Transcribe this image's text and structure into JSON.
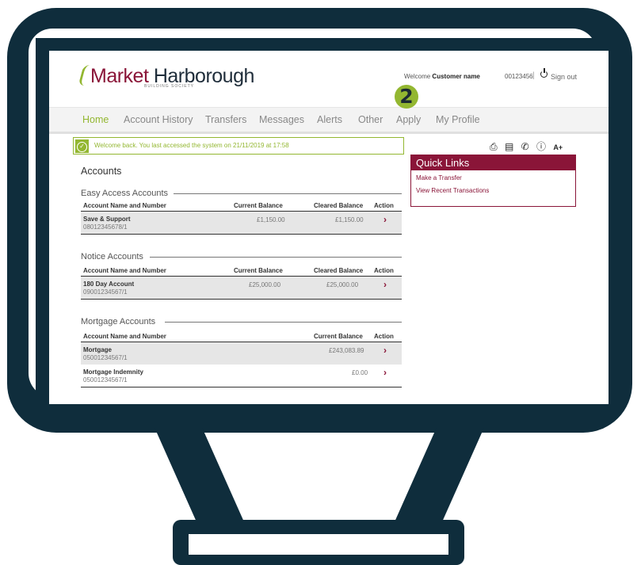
{
  "header": {
    "brand_market": "Market",
    "brand_harborough": " Harborough",
    "brand_subtitle": "BUILDING SOCIETY",
    "welcome_prefix": "Welcome ",
    "customer_name": "Customer name",
    "account_id": "00123456",
    "separator": "|",
    "sign_out": "Sign out"
  },
  "nav": {
    "items": [
      "Home",
      "Account History",
      "Transfers",
      "Messages",
      "Alerts",
      "Other",
      "Apply",
      "My Profile"
    ],
    "step_badge": "2"
  },
  "notice": {
    "text": "Welcome back. You last accessed the system on 21/11/2019 at 17:58"
  },
  "toolbar": {
    "icons": [
      "printer-icon",
      "id-card-icon",
      "phone-icon",
      "help-icon",
      "text-size-icon"
    ],
    "text_size_label": "A+"
  },
  "quick_links": {
    "title": "Quick Links",
    "links": [
      "Make a Transfer",
      "View Recent Transactions"
    ]
  },
  "accounts": {
    "title": "Accounts",
    "easy_access": {
      "title": "Easy Access Accounts",
      "headers": [
        "Account Name and Number",
        "Current Balance",
        "Cleared Balance",
        "Action"
      ],
      "rows": [
        {
          "name": "Save & Support",
          "number": "08012345678/1",
          "current": "£1,150.00",
          "cleared": "£1,150.00"
        }
      ]
    },
    "notice_accounts": {
      "title": "Notice Accounts",
      "headers": [
        "Account Name and Number",
        "Current Balance",
        "Cleared Balance",
        "Action"
      ],
      "rows": [
        {
          "name": "180 Day Account",
          "number": "09001234567/1",
          "current": "£25,000.00",
          "cleared": "£25,000.00"
        }
      ]
    },
    "mortgage": {
      "title": "Mortgage Accounts",
      "headers": [
        "Account Name and Number",
        "Current Balance",
        "Action"
      ],
      "rows": [
        {
          "name": "Mortgage",
          "number": "05001234567/1",
          "current": "£243,083.89"
        },
        {
          "name": "Mortgage Indemnity",
          "number": "05001234567/1",
          "current": "£0.00"
        }
      ]
    },
    "action_glyph": "›"
  },
  "colors": {
    "brand_green": "#93b731",
    "brand_maroon": "#8a1538",
    "monitor_frame": "#0f2d3c"
  }
}
